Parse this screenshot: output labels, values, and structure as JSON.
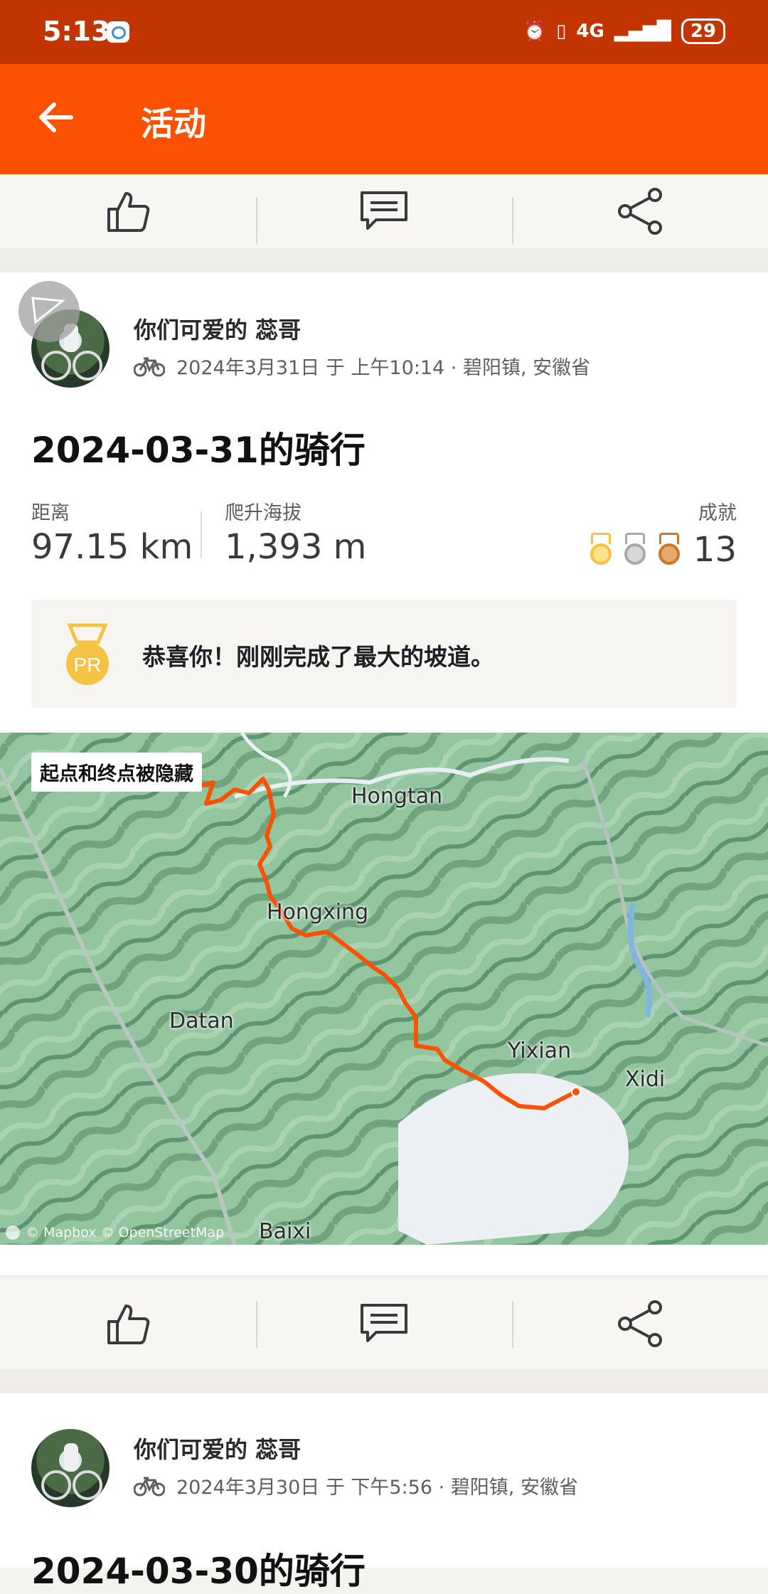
{
  "status_bar": {
    "time": "5:13",
    "network": "4G",
    "battery": "29"
  },
  "app_bar": {
    "title": "活动"
  },
  "activities": [
    {
      "user": "你们可爱的 蕊哥",
      "meta": "2024年3月31日 于 上午10:14 · 碧阳镇, 安徽省",
      "title": "2024-03-31的骑行",
      "stats": {
        "distance_label": "距离",
        "distance_value": "97.15 km",
        "elevation_label": "爬升海拔",
        "elevation_value": "1,393 m",
        "achievements_label": "成就",
        "achievements_value": "13"
      },
      "pr_message": "恭喜你！刚刚完成了最大的坡道。",
      "pr_badge": "PR",
      "map": {
        "hidden_notice": "起点和终点被隐藏",
        "places": [
          "Hongtan",
          "Hongxing",
          "Datan",
          "Yixian",
          "Baixi",
          "Xidi"
        ],
        "credit": "© Mapbox © OpenStreetMap"
      }
    },
    {
      "user": "你们可爱的 蕊哥",
      "meta": "2024年3月30日 于 下午5:56 · 碧阳镇, 安徽省",
      "title": "2024-03-30的骑行"
    }
  ],
  "colors": {
    "brand": "#fc5200",
    "status_bar": "#c23500",
    "route": "#fc5200",
    "gold": "#f5c343",
    "silver": "#a9a9a9",
    "bronze": "#c7782d"
  },
  "icons": [
    "back-arrow-icon",
    "thumbs-up-icon",
    "comment-icon",
    "share-icon",
    "bike-icon",
    "medal-icon",
    "pr-badge-icon"
  ]
}
